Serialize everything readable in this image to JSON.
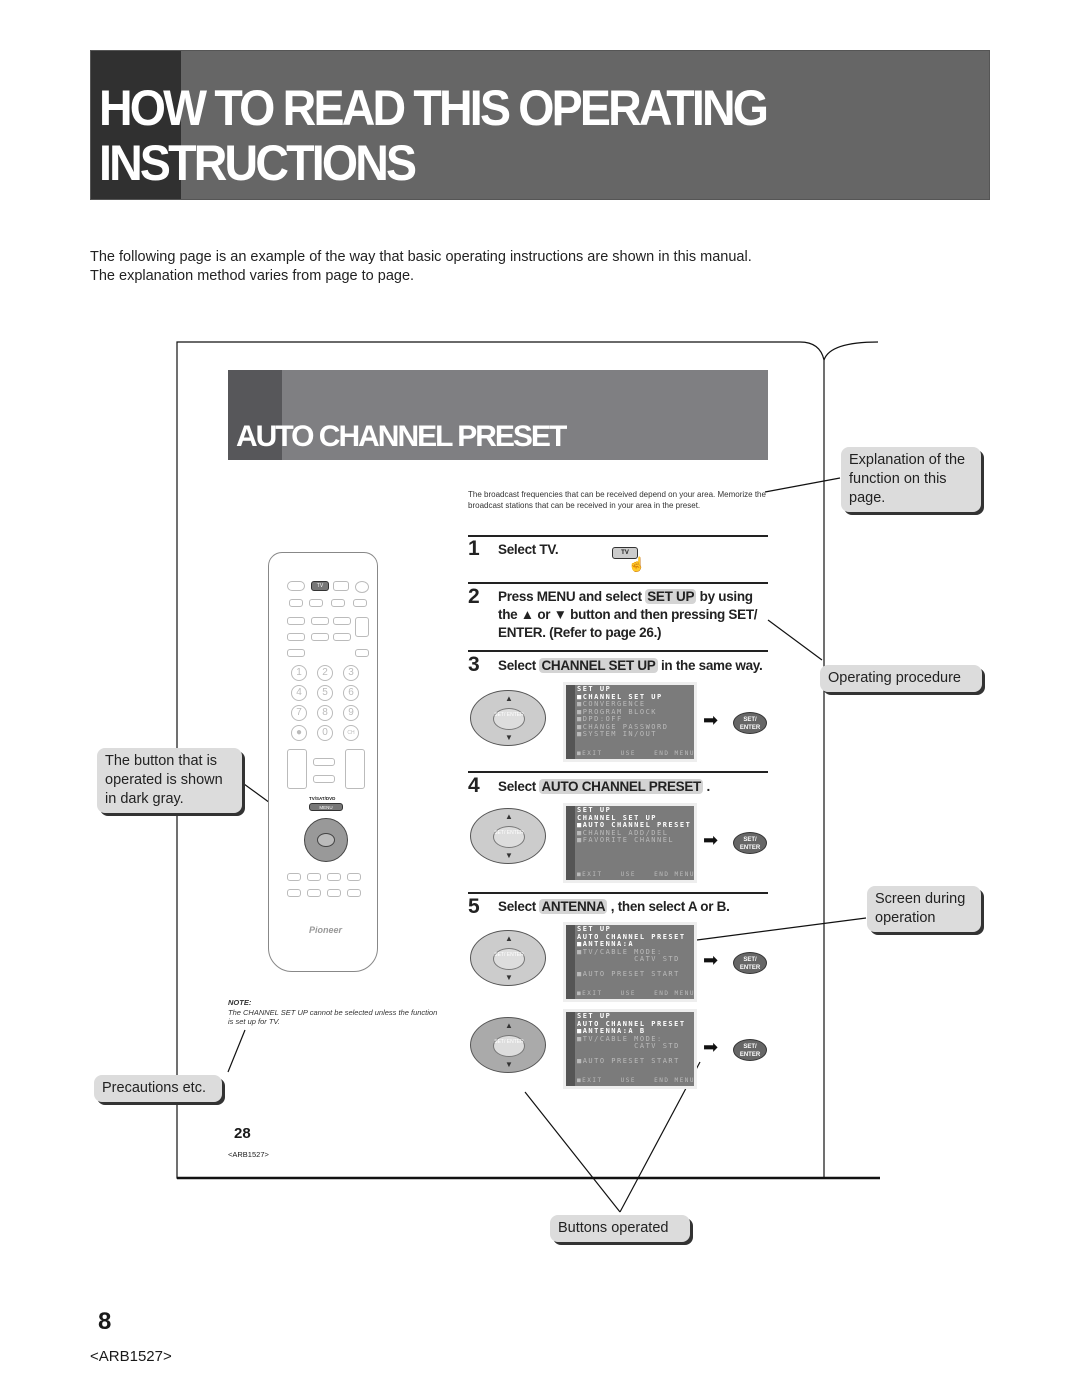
{
  "page": {
    "title_line1": "HOW TO READ THIS OPERATING",
    "title_line2": "INSTRUCTIONS",
    "intro_line1": "The following page is an example of the way that basic operating instructions are shown in this manual.",
    "intro_line2": "The explanation method varies from page to page.",
    "page_number": "8",
    "model_code": "<ARB1527>"
  },
  "sample": {
    "title": "AUTO CHANNEL PRESET",
    "broadcast_note": "The broadcast frequencies that can be received depend on your area. Memorize the broadcast stations that can be received in your area in the preset.",
    "steps": [
      {
        "num": "1",
        "text": "Select TV.",
        "button": "TV"
      },
      {
        "num": "2",
        "pre": "Press MENU and select ",
        "hl": "SET UP",
        "post": " by using the ▲ or ▼ button and then pressing SET/ ENTER. (Refer to page 26.)"
      },
      {
        "num": "3",
        "pre": "Select ",
        "hl": "CHANNEL SET UP",
        "post": " in the same way."
      },
      {
        "num": "4",
        "pre": "Select ",
        "hl": "AUTO CHANNEL PRESET",
        "post": " ."
      },
      {
        "num": "5",
        "pre": "Select ",
        "hl": "ANTENNA",
        "post": " , then select A or B."
      }
    ],
    "osd": [
      {
        "lines": [
          "SET UP",
          "■CHANNEL SET UP",
          "■CONVERGENCE",
          "■PROGRAM BLOCK",
          "■DPD:OFF",
          "■CHANGE PASSWORD",
          "■SYSTEM IN/OUT"
        ],
        "exit": "■EXIT",
        "use": "USE",
        "end": "END MENU"
      },
      {
        "lines": [
          "SET UP",
          "CHANNEL SET UP",
          "■AUTO CHANNEL PRESET",
          "■CHANNEL ADD/DEL",
          "■FAVORITE CHANNEL"
        ],
        "exit": "■EXIT",
        "use": "USE",
        "end": "END MENU"
      },
      {
        "lines": [
          "SET UP",
          "AUTO CHANNEL PRESET",
          "■ANTENNA:A",
          "■TV/CABLE MODE:",
          "          CATV STD",
          "",
          "■AUTO PRESET START"
        ],
        "exit": "■EXIT",
        "use": "USE",
        "end": "END MENU"
      },
      {
        "lines": [
          "SET UP",
          "AUTO CHANNEL PRESET",
          "■ANTENNA:A B",
          "■TV/CABLE MODE:",
          "          CATV STD",
          "",
          "■AUTO PRESET START"
        ],
        "exit": "■EXIT",
        "use": "USE",
        "end": "END MENU"
      }
    ],
    "pad_center": "SET/ ENTER",
    "set_enter": "SET/ ENTER",
    "remote": {
      "tv": "TV",
      "menu_label": "TV/SAT/DVD",
      "menu": "MENU",
      "brand": "Pioneer",
      "numbers": [
        "1",
        "2",
        "3",
        "4",
        "5",
        "6",
        "7",
        "8",
        "9",
        "●",
        "0",
        "CH"
      ]
    },
    "note_title": "NOTE:",
    "note_text": "The CHANNEL SET UP cannot be selected unless the function is set up for TV.",
    "page_number": "28",
    "model_code": "<ARB1527>"
  },
  "callouts": {
    "explanation": "Explanation of the function on this page.",
    "procedure": "Operating procedure",
    "dark_gray": "The button that is operated is shown in dark gray.",
    "screen": "Screen during operation",
    "precautions": "Precautions etc.",
    "buttons": "Buttons operated"
  }
}
